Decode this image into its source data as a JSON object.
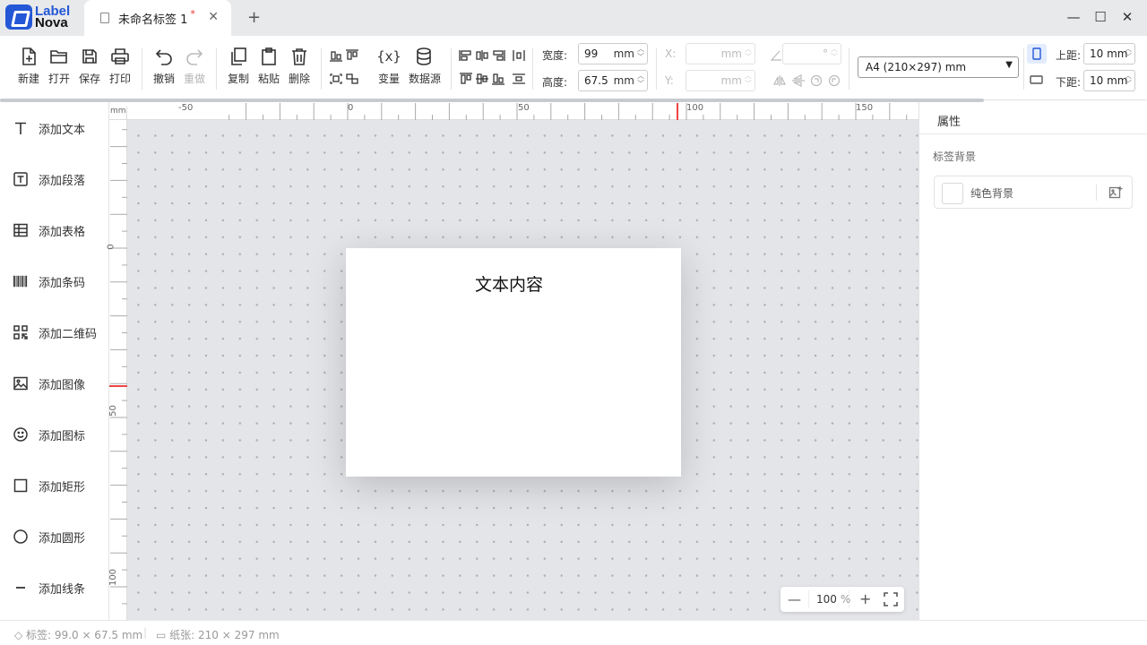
{
  "app": {
    "logo_line1": "Label",
    "logo_line2": "Nova"
  },
  "tab": {
    "title": "未命名标签 1",
    "modified_mark": "*",
    "close": "✕",
    "new": "+"
  },
  "window": {
    "minimize": "—",
    "maximize": "☐",
    "close": "✕"
  },
  "toolbar": {
    "new": "新建",
    "open": "打开",
    "save": "保存",
    "print": "打印",
    "undo": "撤销",
    "redo": "重做",
    "copy": "复制",
    "paste": "粘贴",
    "delete": "删除",
    "variable": "变量",
    "datasource": "数据源",
    "variable_glyph": "{x}"
  },
  "dims": {
    "width_label": "宽度:",
    "width_value": "99",
    "height_label": "高度:",
    "height_value": "67.5",
    "unit": "mm",
    "x_label": "X:",
    "y_label": "Y:",
    "angle_unit": "°",
    "top_margin_label": "上距:",
    "top_margin_value": "10 mm",
    "bottom_margin_label": "下距:",
    "bottom_margin_value": "10 mm"
  },
  "paper_select": {
    "value": "A4 (210×297) mm"
  },
  "sidebar": {
    "items": [
      {
        "label": "添加文本",
        "icon": "text-icon"
      },
      {
        "label": "添加段落",
        "icon": "paragraph-icon"
      },
      {
        "label": "添加表格",
        "icon": "table-icon"
      },
      {
        "label": "添加条码",
        "icon": "barcode-icon"
      },
      {
        "label": "添加二维码",
        "icon": "qrcode-icon"
      },
      {
        "label": "添加图像",
        "icon": "image-icon"
      },
      {
        "label": "添加图标",
        "icon": "smiley-icon"
      },
      {
        "label": "添加矩形",
        "icon": "rectangle-icon"
      },
      {
        "label": "添加圆形",
        "icon": "circle-icon"
      },
      {
        "label": "添加线条",
        "icon": "line-icon"
      }
    ]
  },
  "ruler": {
    "unit": "mm",
    "h_ticks": [
      "-50",
      "0",
      "50",
      "100",
      "150"
    ],
    "v_ticks": [
      "0",
      "50",
      "100"
    ]
  },
  "canvas": {
    "text_content": "文本内容"
  },
  "zoom": {
    "minus": "—",
    "value": "100",
    "unit": "%",
    "plus": "+"
  },
  "properties": {
    "title": "属性",
    "section": "标签背景",
    "bg_option": "纯色背景"
  },
  "status": {
    "label_size": "标签: 99.0 × 67.5 mm",
    "paper_size": "纸张: 210 × 297 mm",
    "separator": "|"
  },
  "colors": {
    "accent": "#2457d6",
    "modified": "#e33333",
    "canvas_bg": "#e4e5e9"
  }
}
